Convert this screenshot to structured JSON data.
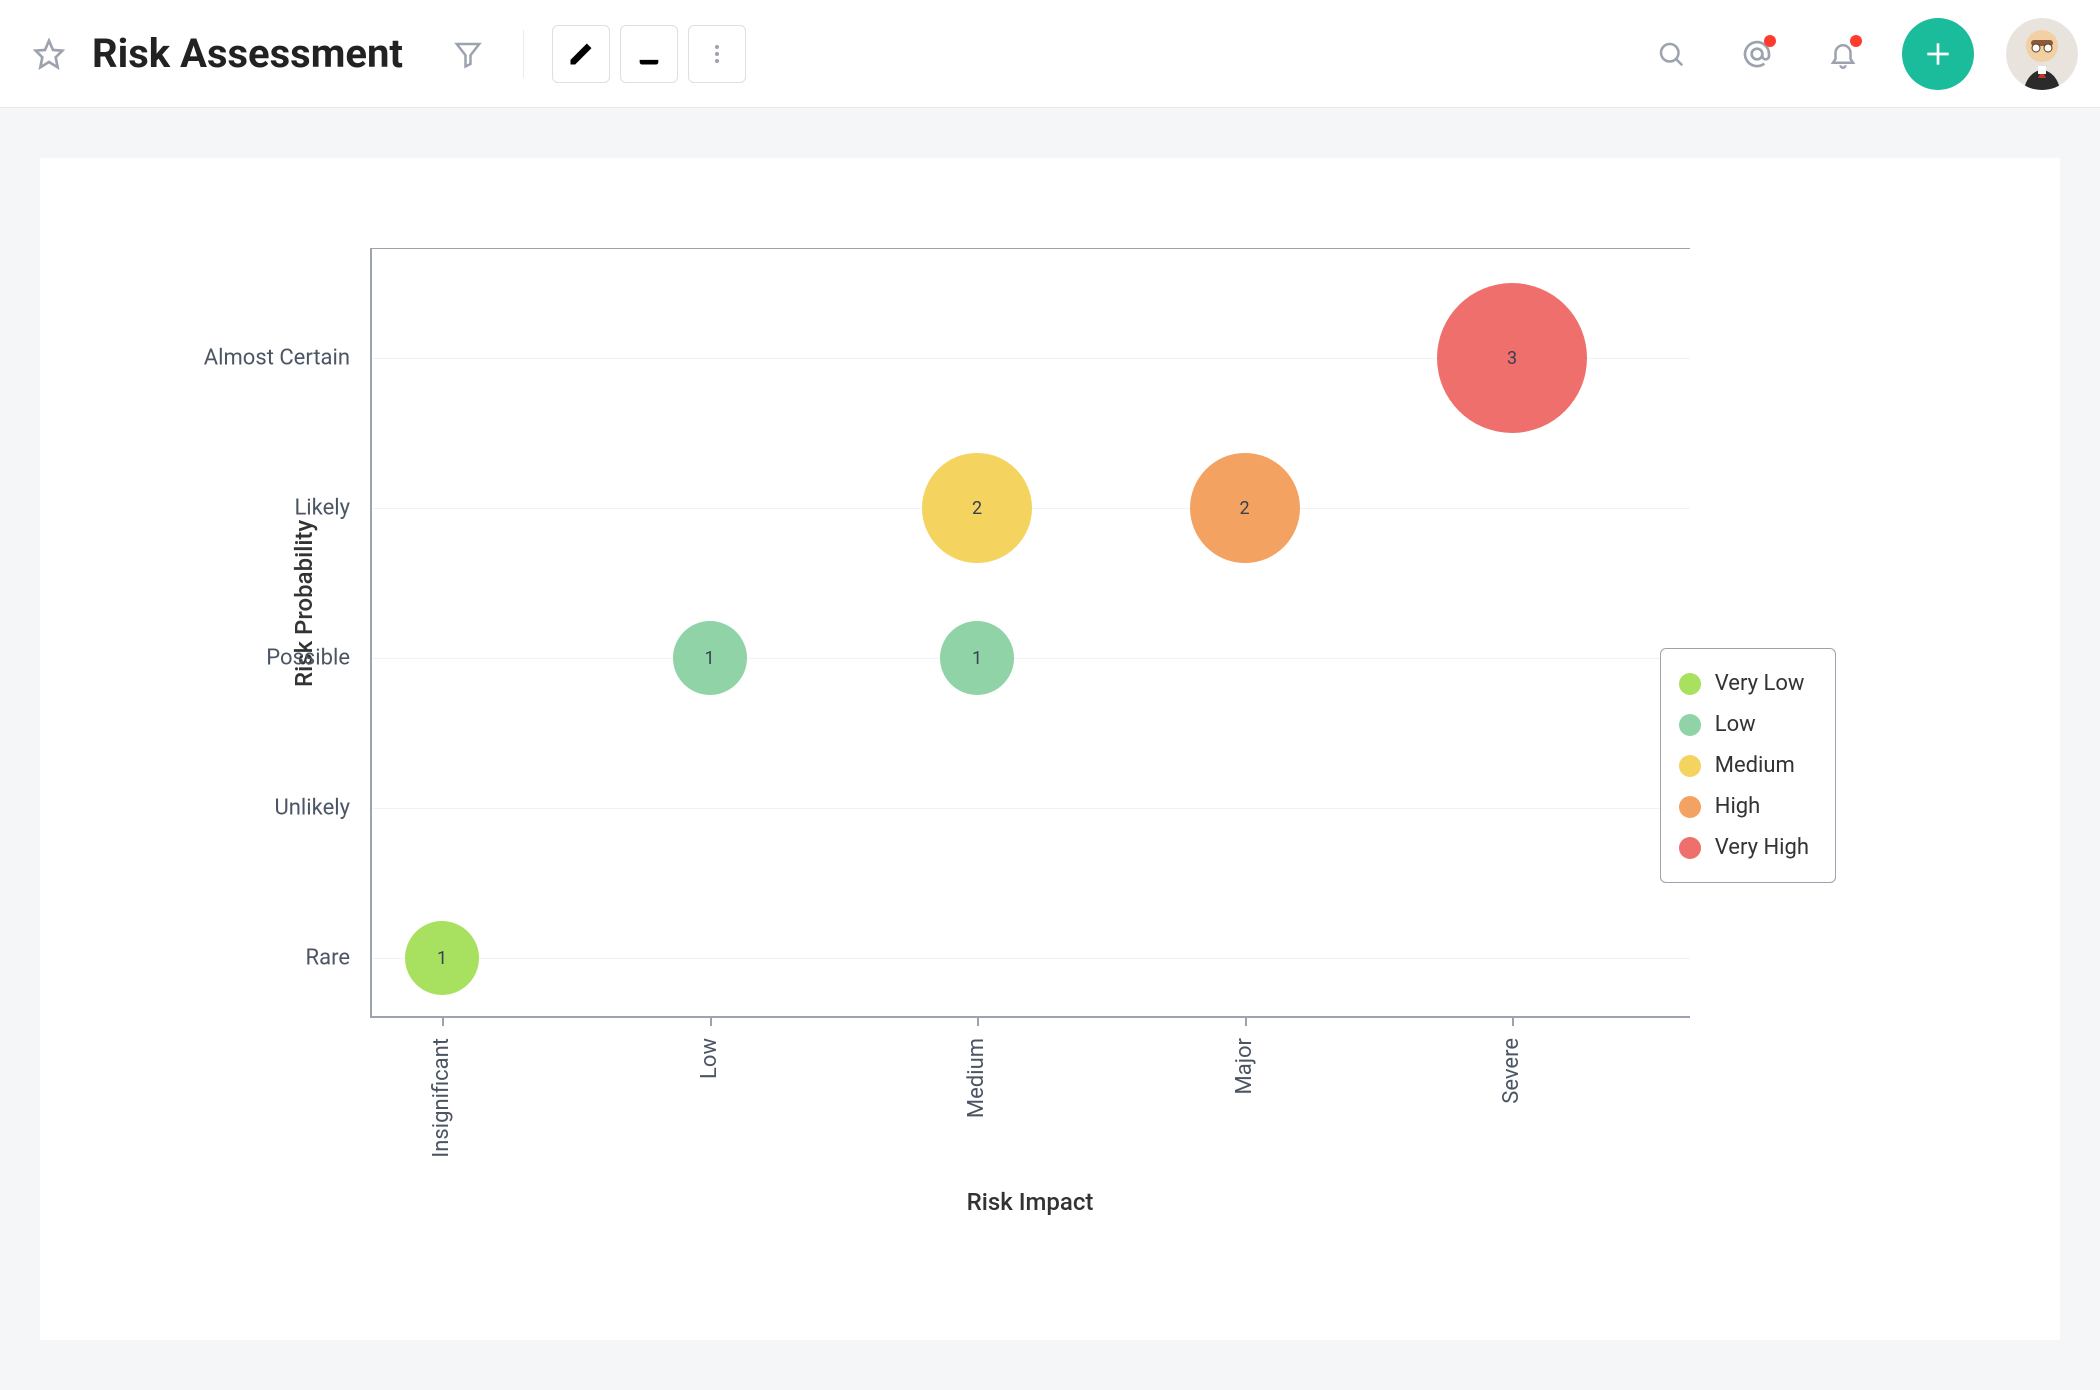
{
  "header": {
    "title": "Risk Assessment",
    "icons": {
      "star": "star-icon",
      "filter": "filter-icon",
      "edit": "pencil-icon",
      "download": "download-icon",
      "more": "more-vertical-icon",
      "search": "search-icon",
      "mentions": "at-icon",
      "notifications": "bell-icon",
      "add": "plus-icon",
      "avatar": "user-avatar"
    }
  },
  "chart_data": {
    "type": "scatter",
    "title": "",
    "xlabel": "Risk Impact",
    "ylabel": "Risk Probability",
    "x_categories": [
      "Insignificant",
      "Low",
      "Medium",
      "Major",
      "Severe"
    ],
    "y_categories": [
      "Rare",
      "Unlikely",
      "Possible",
      "Likely",
      "Almost Certain"
    ],
    "legend": [
      {
        "name": "Very Low",
        "color": "#a8e05f"
      },
      {
        "name": "Low",
        "color": "#8fd3a6"
      },
      {
        "name": "Medium",
        "color": "#f4d35e"
      },
      {
        "name": "High",
        "color": "#f4a261"
      },
      {
        "name": "Very High",
        "color": "#ef6f6c"
      }
    ],
    "points": [
      {
        "x": "Insignificant",
        "y": "Rare",
        "value": 1,
        "level": "Very Low"
      },
      {
        "x": "Low",
        "y": "Possible",
        "value": 1,
        "level": "Low"
      },
      {
        "x": "Medium",
        "y": "Possible",
        "value": 1,
        "level": "Low"
      },
      {
        "x": "Medium",
        "y": "Likely",
        "value": 2,
        "level": "Medium"
      },
      {
        "x": "Major",
        "y": "Likely",
        "value": 2,
        "level": "High"
      },
      {
        "x": "Severe",
        "y": "Almost Certain",
        "value": 3,
        "level": "Very High"
      }
    ]
  }
}
